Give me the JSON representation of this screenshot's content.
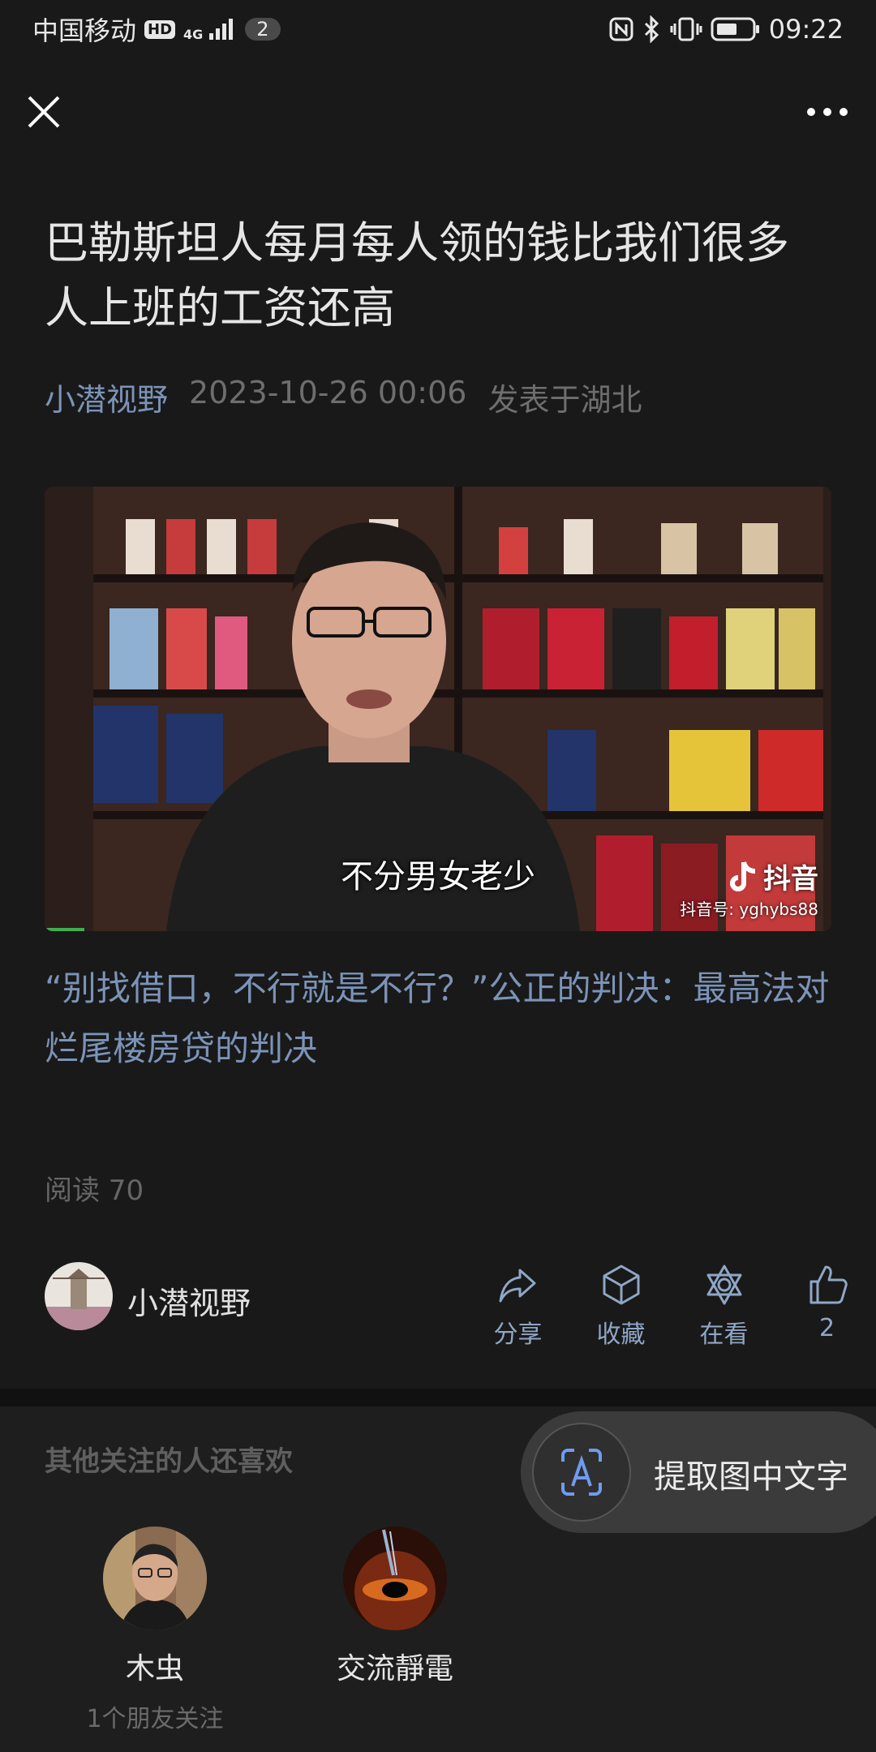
{
  "status_bar": {
    "carrier": "中国移动",
    "hd": "HD",
    "network": "4G",
    "notification_count": "2",
    "time": "09:22"
  },
  "article": {
    "title": "巴勒斯坦人每月每人领的钱比我们很多人上班的工资还高",
    "author": "小潜视野",
    "datetime": "2023-10-26 00:06",
    "location": "发表于湖北",
    "video": {
      "subtitle": "不分男女老少",
      "watermark_brand": "抖音",
      "watermark_id": "抖音号: yghybs88",
      "progress_percent": 5
    },
    "related_link": "“别找借口，不行就是不行？”公正的判决：最高法对烂尾楼房贷的判决",
    "read_count": "阅读 70"
  },
  "author_bar": {
    "name": "小潜视野",
    "actions": [
      {
        "label": "分享",
        "icon": "share-icon"
      },
      {
        "label": "收藏",
        "icon": "cube-icon"
      },
      {
        "label": "在看",
        "icon": "star-of-david-icon"
      },
      {
        "label": "2",
        "icon": "thumbs-up-icon"
      }
    ]
  },
  "recommendations": {
    "heading": "其他关注的人还喜欢",
    "items": [
      {
        "name": "木虫",
        "sub": "1个朋友关注"
      },
      {
        "name": "交流靜電",
        "sub": ""
      }
    ]
  },
  "ocr_button": {
    "label": "提取图中文字"
  },
  "colors": {
    "background": "#191919",
    "link": "#7b93b8",
    "action_label": "#8fa6c6"
  }
}
